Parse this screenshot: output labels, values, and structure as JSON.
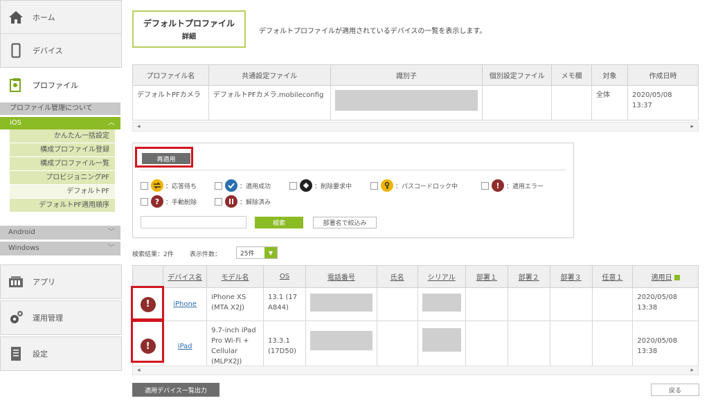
{
  "sidebar": {
    "home": "ホーム",
    "devices": "デバイス",
    "profile": "プロファイル",
    "about_profile": "プロファイル管理について",
    "ios": "iOS",
    "ios_items": [
      "かんたん一括設定",
      "構成プロファイル登録",
      "構成プロファイル一覧",
      "プロビジョニングPF",
      "デフォルトPF",
      "デフォルトPF適用順序"
    ],
    "android": "Android",
    "windows": "Windows",
    "apps": "アプリ",
    "ops": "運用管理",
    "settings": "設定"
  },
  "header": {
    "title_line1": "デフォルトプロファイル",
    "title_line2": "詳細",
    "description": "デフォルトプロファイルが適用されているデバイスの一覧を表示します。"
  },
  "profile_table": {
    "headers": [
      "プロファイル名",
      "共通設定ファイル",
      "識別子",
      "個別設定ファイル",
      "メモ欄",
      "対象",
      "作成日時"
    ],
    "row": {
      "name": "デフォルトPFカメラ",
      "common_file": "デフォルトPFカメラ.mobileconfig",
      "target": "全体",
      "created": "2020/05/08 13:37"
    }
  },
  "filter": {
    "reapply": "再適用",
    "statuses": [
      "：応答待ち",
      "：適用成功",
      "：削除要求中",
      "：パスコードロック中",
      "：適用エラー",
      "：手動削除",
      "：解除済み"
    ],
    "search_placeholder": "",
    "search_button": "検索",
    "dept_button": "部署名で絞込み"
  },
  "results": {
    "count_label": "検索結果：2件",
    "per_page_label": "表示件数：",
    "per_page_value": "25件"
  },
  "device_table": {
    "headers": [
      "",
      "デバイス名",
      "モデル名",
      "OS",
      "電話番号",
      "氏名",
      "シリアル",
      "部署１",
      "部署２",
      "部署３",
      "任意１",
      "適用日"
    ],
    "rows": [
      {
        "device": "iPhone",
        "model": "iPhone XS (MTA X2J)",
        "os": "13.1 (17 A844)",
        "date": "2020/05/08 13:38"
      },
      {
        "device": "iPad",
        "model": "9.7-inch iPad Pro Wi-Fi + Cellular (MLPX2J)",
        "os": "13.3.1 (17D50)",
        "date": "2020/05/08 13:38"
      }
    ]
  },
  "footer": {
    "export_button": "適用デバイス一覧出力",
    "back_button": "戻る"
  },
  "colors": {
    "accent_green": "#8bbb25",
    "error_red": "#d3141f"
  }
}
